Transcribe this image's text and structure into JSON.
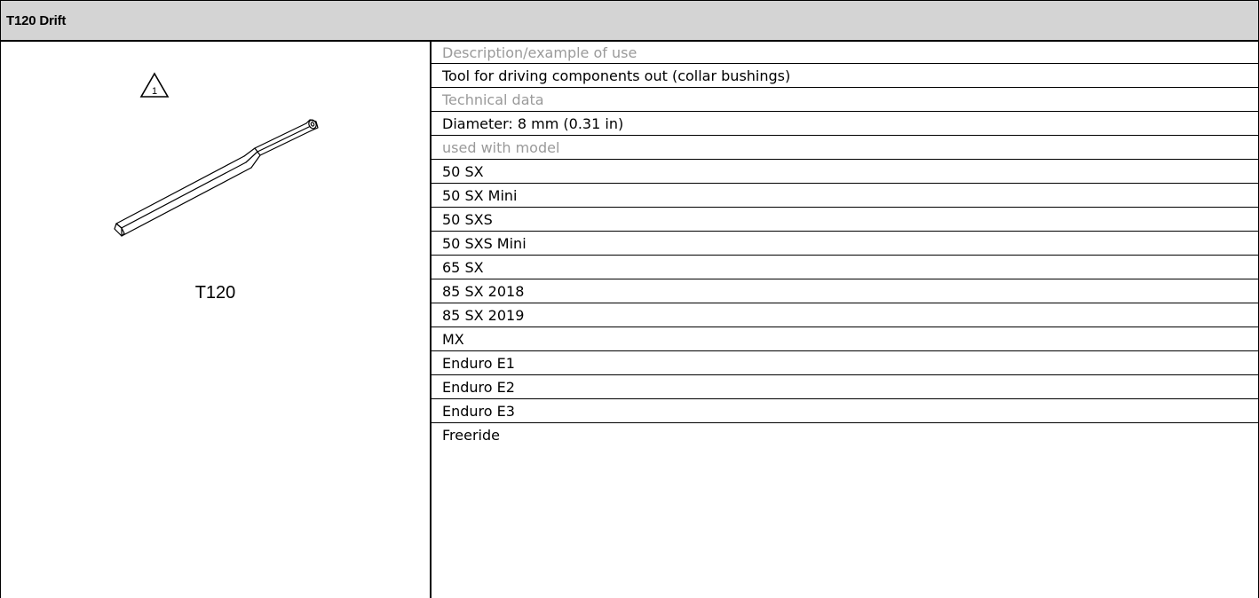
{
  "header": {
    "title": "T120 Drift"
  },
  "figure": {
    "warning_icon_number": "1",
    "caption": "T120",
    "icons": [
      "warning-triangle-icon",
      "drift-tool-drawing"
    ]
  },
  "details": {
    "description_heading": "Description/example of use",
    "description": "Tool for driving components out (collar bushings)",
    "technical_heading": "Technical data",
    "technical": "Diameter: 8 mm (0.31 in)",
    "models_heading": "used with model",
    "models": [
      "50 SX",
      "50 SX Mini",
      "50 SXS",
      "50 SXS Mini",
      "65 SX",
      "85 SX 2018",
      "85 SX 2019",
      "MX",
      "Enduro E1",
      "Enduro E2",
      "Enduro E3",
      "Freeride"
    ]
  },
  "colors": {
    "header_background": "#d4d4d4",
    "heading_text": "#9a9a9a",
    "border": "#000000"
  }
}
